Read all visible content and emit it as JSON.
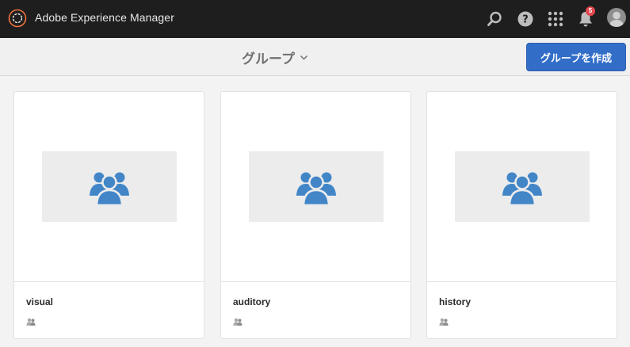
{
  "header": {
    "app_title": "Adobe Experience Manager",
    "notification_count": "5",
    "icons": [
      "adobe-logo-icon",
      "search-icon",
      "help-icon",
      "apps-grid-icon",
      "bell-icon",
      "user-avatar"
    ]
  },
  "actionbar": {
    "breadcrumb_title": "グループ",
    "create_button_label": "グループを作成"
  },
  "cards": [
    {
      "title": "visual",
      "thumbnail_icon": "group-icon",
      "type_icon": "group-small-icon"
    },
    {
      "title": "auditory",
      "thumbnail_icon": "group-icon",
      "type_icon": "group-small-icon"
    },
    {
      "title": "history",
      "thumbnail_icon": "group-icon",
      "type_icon": "group-small-icon"
    }
  ],
  "colors": {
    "topbar": "#1e1e1e",
    "accent_button": "#326ec8",
    "group_icon": "#4286c8",
    "badge": "#e34850",
    "logo": "#f0733d"
  }
}
